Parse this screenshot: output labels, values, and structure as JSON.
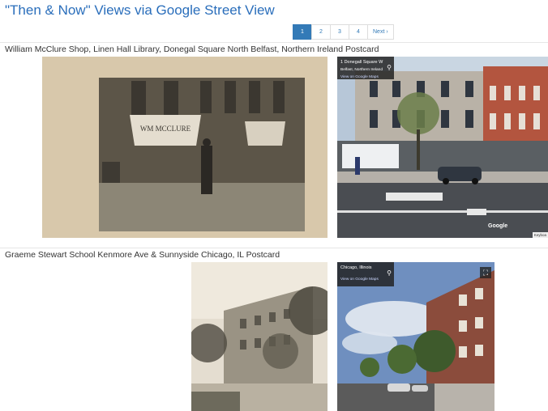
{
  "page": {
    "title": "\"Then & Now\" Views via Google Street View"
  },
  "pagination": {
    "pages": [
      "1",
      "2",
      "3",
      "4"
    ],
    "active_page": "1",
    "next_label": "Next ›"
  },
  "entries": [
    {
      "caption": "William McClure Shop, Linen Hall Library, Donegal Square North Belfast, Northern Ireland Postcard",
      "postcard_sign_text": "WM MCCLURE",
      "street_view": {
        "location_title": "1 Donegall Square W",
        "location_subtitle": "Belfast, Northern Ireland",
        "maps_link": "View on Google Maps",
        "logo_text": "Google",
        "keyboard_text": "Keyboa"
      }
    },
    {
      "caption": "Graeme Stewart School Kenmore Ave & Sunnyside Chicago, IL Postcard",
      "street_view": {
        "location_title": "Chicago, Illinois",
        "maps_link": "View on Google Maps"
      }
    }
  ],
  "icons": {
    "pin": "location-pin-icon",
    "expand": "fullscreen-icon"
  }
}
